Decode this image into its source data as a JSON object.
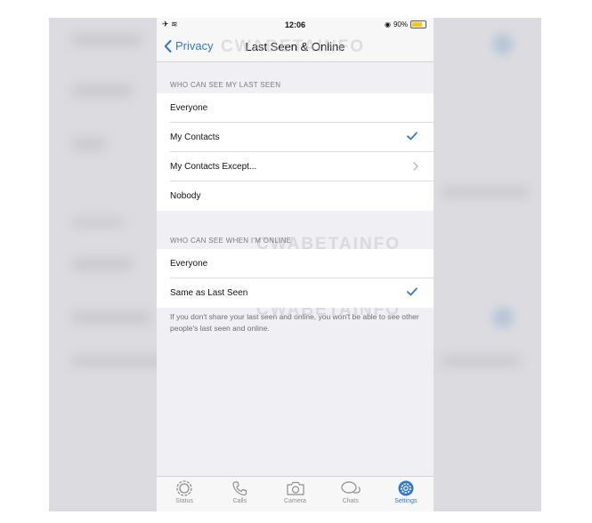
{
  "status_bar": {
    "left_icons": "✈ ≋",
    "time": "12:06",
    "battery_text": "90%"
  },
  "nav": {
    "back_label": "Privacy",
    "title": "Last Seen & Online"
  },
  "watermark_text": "CWABETAINFO",
  "last_seen_section": {
    "header": "WHO CAN SEE MY LAST SEEN",
    "options": [
      {
        "label": "Everyone",
        "selected": false
      },
      {
        "label": "My Contacts",
        "selected": true
      },
      {
        "label": "My Contacts Except...",
        "selected": false,
        "has_chevron": true
      },
      {
        "label": "Nobody",
        "selected": false
      }
    ]
  },
  "online_section": {
    "header": "WHO CAN SEE WHEN I'M ONLINE",
    "options": [
      {
        "label": "Everyone",
        "selected": false
      },
      {
        "label": "Same as Last Seen",
        "selected": true
      }
    ],
    "footer": "If you don't share your last seen and online, you won't be able to see other people's last seen and online."
  },
  "tab_bar": {
    "tabs": [
      {
        "label": "Status",
        "icon": "status-icon",
        "active": false
      },
      {
        "label": "Calls",
        "icon": "phone-icon",
        "active": false
      },
      {
        "label": "Camera",
        "icon": "camera-icon",
        "active": false
      },
      {
        "label": "Chats",
        "icon": "chats-icon",
        "active": false
      },
      {
        "label": "Settings",
        "icon": "gear-icon",
        "active": true
      }
    ]
  },
  "colors": {
    "accent": "#3478c8",
    "background": "#efeff4",
    "separator": "#dcdce0",
    "battery": "#f5c518"
  }
}
